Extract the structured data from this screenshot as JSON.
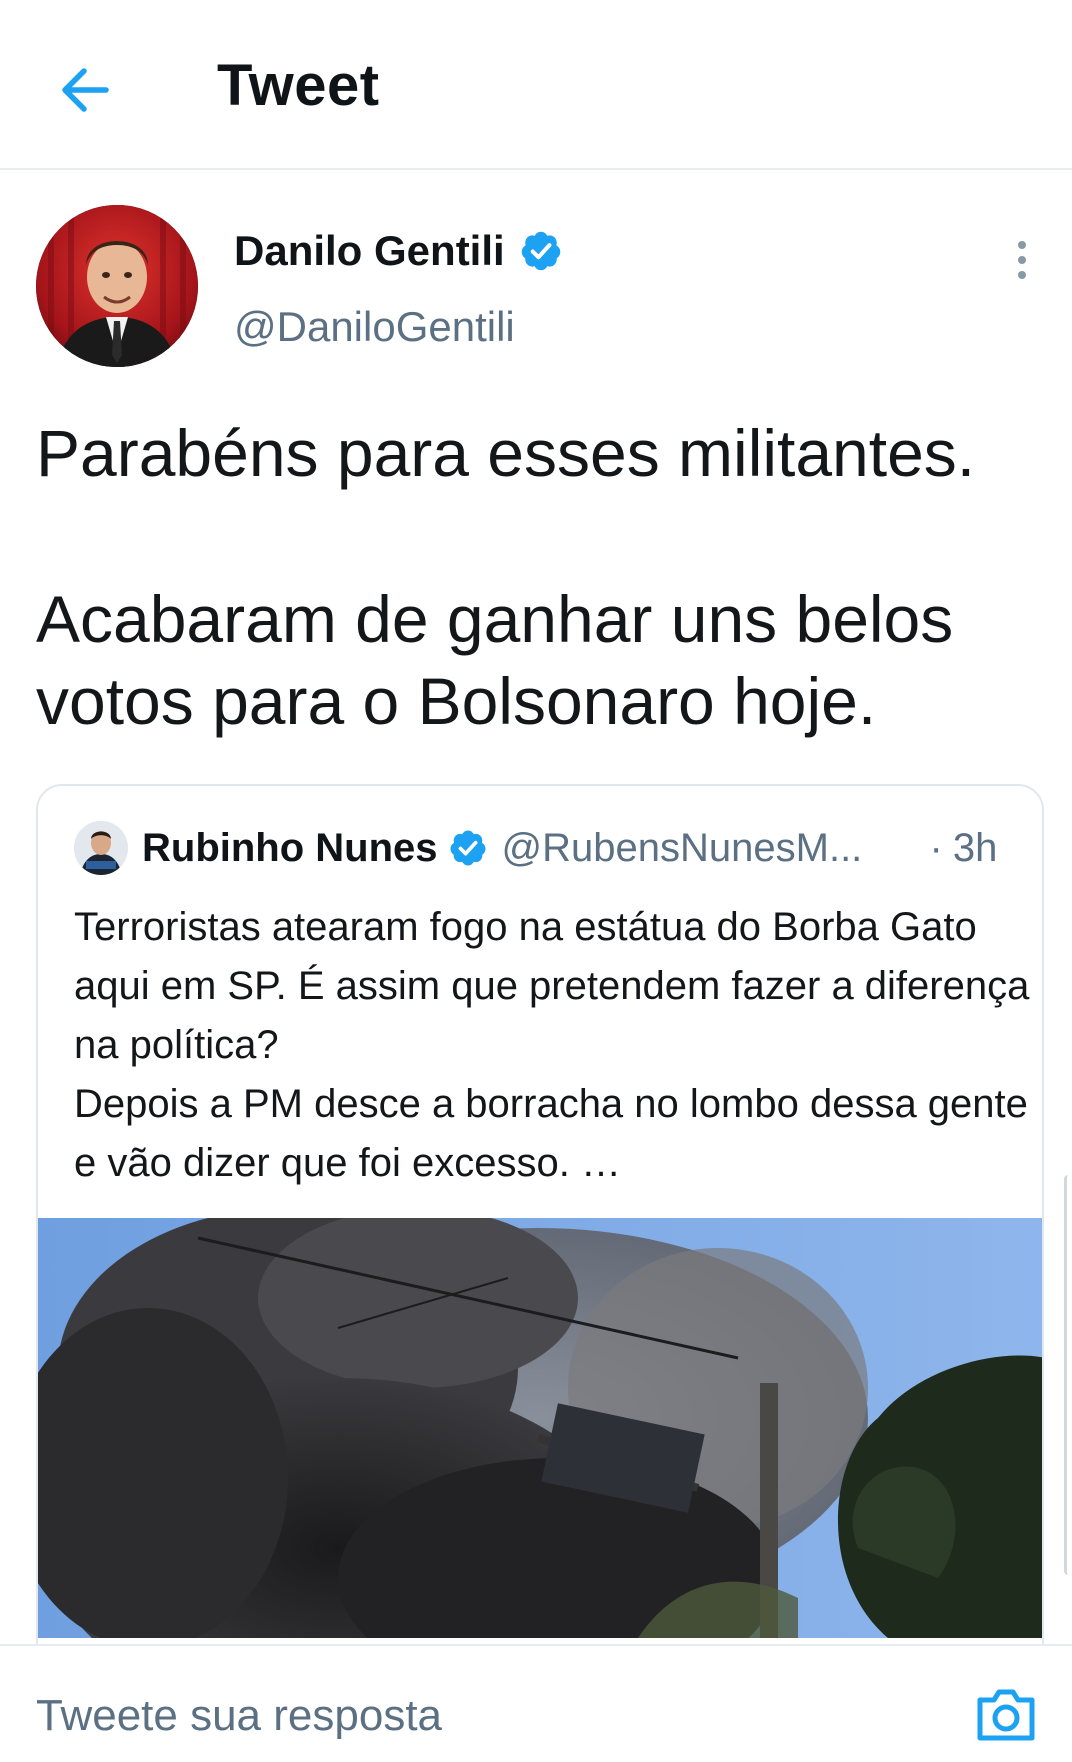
{
  "header": {
    "title": "Tweet",
    "back_icon": "arrow-left-icon"
  },
  "tweet": {
    "author_name": "Danilo Gentili",
    "author_handle": "@DaniloGentili",
    "verified": true,
    "text_paragraphs": [
      "Parabéns para esses militantes.",
      "Acabaram de ganhar uns belos votos para o Bolsonaro hoje."
    ]
  },
  "quoted_tweet": {
    "author_name": "Rubinho Nunes",
    "author_handle": "@RubensNunesM...",
    "verified": true,
    "dot": "·",
    "time": "3h",
    "text_lines": [
      "Terroristas atearam fogo na estátua do Borba Gato aqui em SP. É assim que pretendem fazer a diferença na política?",
      "Depois a PM desce a borracha no lombo dessa gente e vão dizer que foi excesso. …"
    ]
  },
  "reply": {
    "placeholder": "Tweete sua resposta",
    "camera_icon": "camera-icon"
  },
  "colors": {
    "accent": "#1DA1F2",
    "secondary_text": "#5b7083",
    "border": "#e1e8ed"
  }
}
